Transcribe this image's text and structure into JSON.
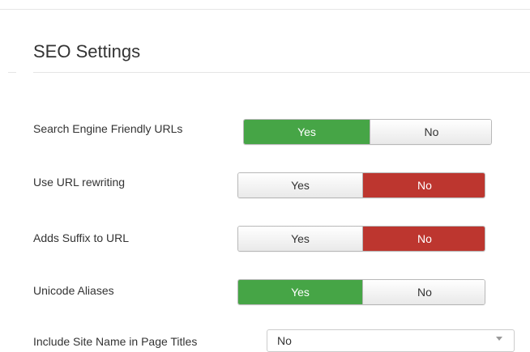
{
  "section": {
    "title": "SEO Settings"
  },
  "colors": {
    "yes_active": "#46a546",
    "no_active": "#bd362f"
  },
  "settings": [
    {
      "label": "Search Engine Friendly URLs",
      "yes_label": "Yes",
      "no_label": "No",
      "value": "Yes"
    },
    {
      "label": "Use URL rewriting",
      "yes_label": "Yes",
      "no_label": "No",
      "value": "No"
    },
    {
      "label": "Adds Suffix to URL",
      "yes_label": "Yes",
      "no_label": "No",
      "value": "No"
    },
    {
      "label": "Unicode Aliases",
      "yes_label": "Yes",
      "no_label": "No",
      "value": "Yes"
    }
  ],
  "site_name_in_titles": {
    "label": "Include Site Name in Page Titles",
    "selected": "No",
    "icon": "chevron-down-icon"
  }
}
